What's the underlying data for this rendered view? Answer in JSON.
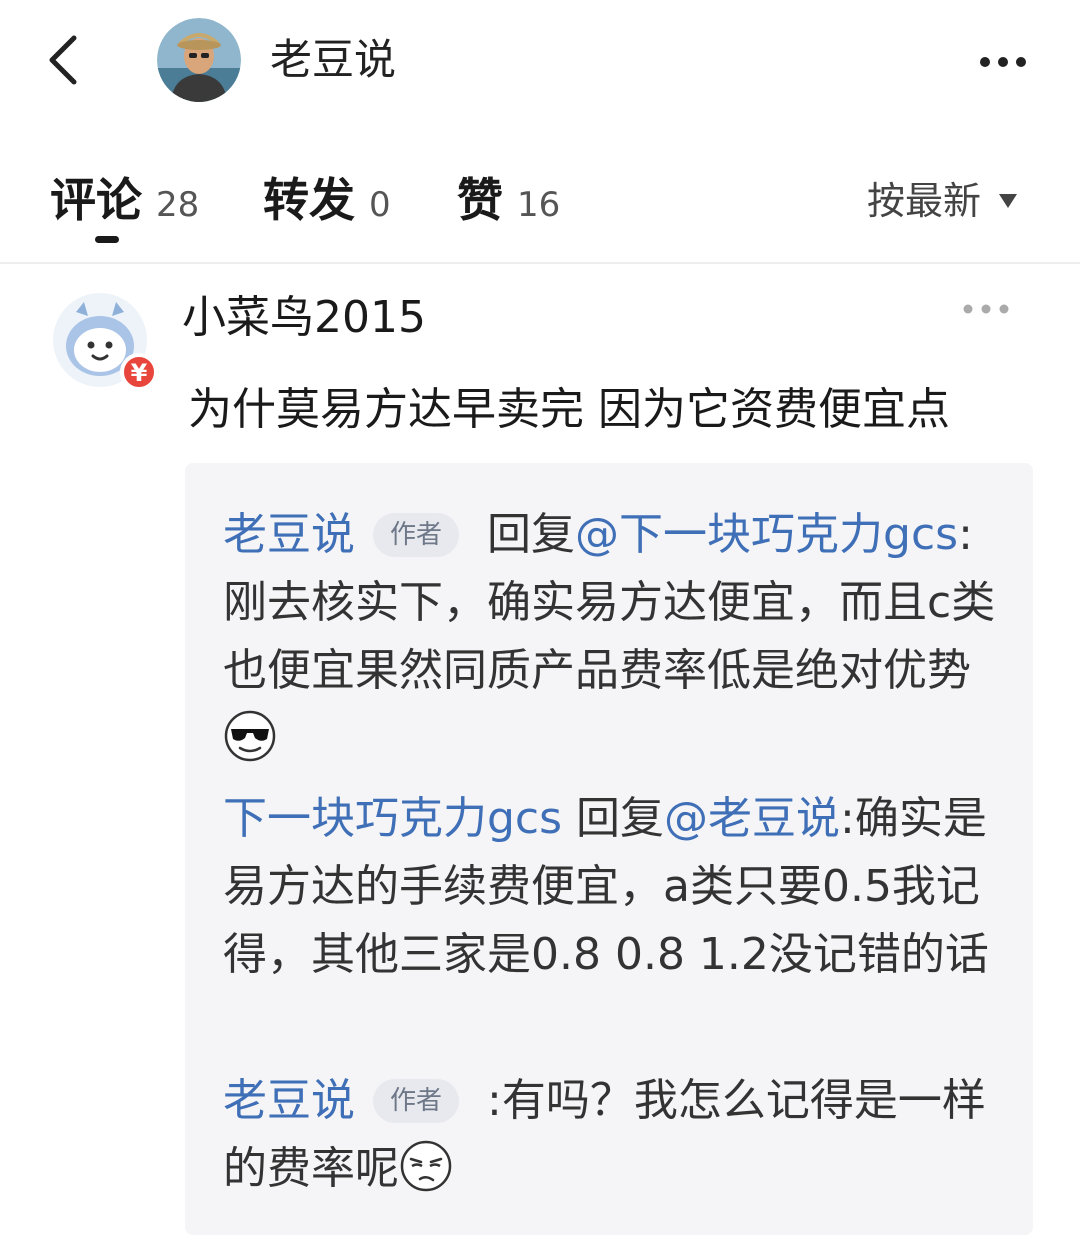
{
  "header": {
    "title": "老豆说"
  },
  "tabs": [
    {
      "label": "评论",
      "count": "28"
    },
    {
      "label": "转发",
      "count": "0"
    },
    {
      "label": "赞",
      "count": "16"
    }
  ],
  "sort": {
    "label": "按最新"
  },
  "comment": {
    "username": "小菜鸟2015",
    "text": "为什莫易方达早卖完 因为它资费便宜点",
    "replies": [
      {
        "author": "老豆说",
        "badge": "作者",
        "reply_word": "回复",
        "mention": "@下一块巧克力gcs",
        "text": ":刚去核实下，确实易方达便宜，而且c类也便宜果然同质产品费率低是绝对优势"
      },
      {
        "author": "下一块巧克力gcs",
        "reply_word": "回复",
        "mention": "@老豆说",
        "text": ":确实是易方达的手续费便宜，a类只要0.5我记得，其他三家是0.8 0.8 1.2没记错的话"
      },
      {
        "author": "老豆说",
        "badge": "作者",
        "text": ":有吗？我怎么记得是一样的费率呢"
      }
    ]
  },
  "icons": {
    "back": "chevron-left-icon",
    "more": "more-dots-icon",
    "sort_arrow": "caret-down-icon",
    "emoji_cool": "sunglasses-emoji-icon",
    "emoji_doubt": "skeptical-emoji-icon",
    "vip_badge": "yuan-badge-icon"
  },
  "colors": {
    "link": "#3f6fb6",
    "badge_red": "#e8463c",
    "reply_bg": "#f5f5f7"
  }
}
